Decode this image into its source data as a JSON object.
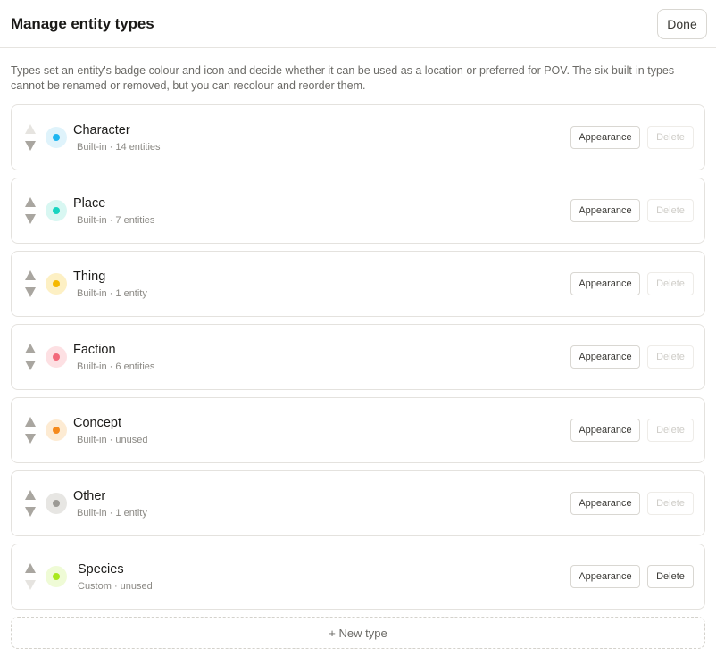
{
  "header": {
    "title": "Manage entity types",
    "done_label": "Done"
  },
  "description": "Types set an entity's badge colour and icon and decide whether it can be used as a location or preferred for POV. The six built-in types cannot be renamed or removed, but you can recolour and reorder them.",
  "labels": {
    "appearance": "Appearance",
    "delete": "Delete",
    "new_type": "+ New type"
  },
  "types": [
    {
      "name": "Character",
      "meta": "Built-in · 14 entities",
      "color": "#1fb6f0",
      "bg": "#dff3fb",
      "up_enabled": false,
      "down_enabled": true,
      "deletable": false
    },
    {
      "name": "Place",
      "meta": "Built-in · 7 entities",
      "color": "#18d4c0",
      "bg": "#d8f7f2",
      "up_enabled": true,
      "down_enabled": true,
      "deletable": false
    },
    {
      "name": "Thing",
      "meta": "Built-in · 1 entity",
      "color": "#f5b800",
      "bg": "#fdf0c4",
      "up_enabled": true,
      "down_enabled": true,
      "deletable": false
    },
    {
      "name": "Faction",
      "meta": "Built-in · 6 entities",
      "color": "#f2697a",
      "bg": "#fde0e3",
      "up_enabled": true,
      "down_enabled": true,
      "deletable": false
    },
    {
      "name": "Concept",
      "meta": "Built-in · unused",
      "color": "#f58a1c",
      "bg": "#fdebd3",
      "up_enabled": true,
      "down_enabled": true,
      "deletable": false
    },
    {
      "name": "Other",
      "meta": "Built-in · 1 entity",
      "color": "#9c9a95",
      "bg": "#e7e6e3",
      "up_enabled": true,
      "down_enabled": true,
      "deletable": false
    },
    {
      "name": "Species",
      "meta": "Custom · unused",
      "color": "#a8e81e",
      "bg": "#effbd6",
      "up_enabled": true,
      "down_enabled": false,
      "deletable": true
    }
  ]
}
